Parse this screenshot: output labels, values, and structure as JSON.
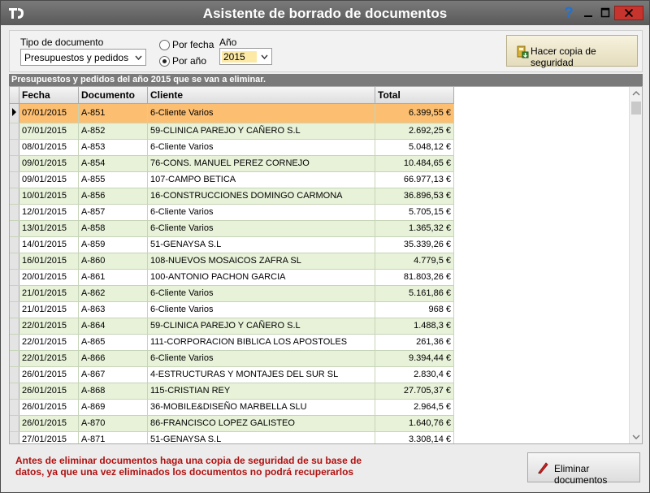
{
  "window": {
    "title": "Asistente de borrado de documentos"
  },
  "filters": {
    "doc_type_label": "Tipo de documento",
    "doc_type_value": "Presupuestos y pedidos",
    "radio_date_label": "Por fecha",
    "radio_year_label": "Por año",
    "year_label": "Año",
    "year_value": "2015",
    "backup_label": "Hacer copia de seguridad"
  },
  "grid": {
    "caption": "Presupuestos y pedidos del año 2015 que se van a eliminar.",
    "headers": [
      "Fecha",
      "Documento",
      "Cliente",
      "Total"
    ],
    "rows": [
      {
        "fecha": "07/01/2015",
        "documento": "A-851",
        "cliente": "6-Cliente Varios",
        "total": "6.399,55 €"
      },
      {
        "fecha": "07/01/2015",
        "documento": "A-852",
        "cliente": "59-CLINICA PAREJO Y CAÑERO S.L",
        "total": "2.692,25 €"
      },
      {
        "fecha": "08/01/2015",
        "documento": "A-853",
        "cliente": "6-Cliente Varios",
        "total": "5.048,12 €"
      },
      {
        "fecha": "09/01/2015",
        "documento": "A-854",
        "cliente": "76-CONS. MANUEL PEREZ CORNEJO",
        "total": "10.484,65 €"
      },
      {
        "fecha": "09/01/2015",
        "documento": "A-855",
        "cliente": "107-CAMPO BETICA",
        "total": "66.977,13 €"
      },
      {
        "fecha": "10/01/2015",
        "documento": "A-856",
        "cliente": "16-CONSTRUCCIONES DOMINGO CARMONA",
        "total": "36.896,53 €"
      },
      {
        "fecha": "12/01/2015",
        "documento": "A-857",
        "cliente": "6-Cliente Varios",
        "total": "5.705,15 €"
      },
      {
        "fecha": "13/01/2015",
        "documento": "A-858",
        "cliente": "6-Cliente Varios",
        "total": "1.365,32 €"
      },
      {
        "fecha": "14/01/2015",
        "documento": "A-859",
        "cliente": "51-GENAYSA S.L",
        "total": "35.339,26 €"
      },
      {
        "fecha": "16/01/2015",
        "documento": "A-860",
        "cliente": "108-NUEVOS MOSAICOS ZAFRA SL",
        "total": "4.779,5 €"
      },
      {
        "fecha": "20/01/2015",
        "documento": "A-861",
        "cliente": "100-ANTONIO PACHON GARCIA",
        "total": "81.803,26 €"
      },
      {
        "fecha": "21/01/2015",
        "documento": "A-862",
        "cliente": "6-Cliente Varios",
        "total": "5.161,86 €"
      },
      {
        "fecha": "21/01/2015",
        "documento": "A-863",
        "cliente": "6-Cliente Varios",
        "total": "968 €"
      },
      {
        "fecha": "22/01/2015",
        "documento": "A-864",
        "cliente": "59-CLINICA PAREJO Y CAÑERO S.L",
        "total": "1.488,3 €"
      },
      {
        "fecha": "22/01/2015",
        "documento": "A-865",
        "cliente": "111-CORPORACION BIBLICA LOS APOSTOLES",
        "total": "261,36 €"
      },
      {
        "fecha": "22/01/2015",
        "documento": "A-866",
        "cliente": "6-Cliente Varios",
        "total": "9.394,44 €"
      },
      {
        "fecha": "26/01/2015",
        "documento": "A-867",
        "cliente": "4-ESTRUCTURAS Y MONTAJES DEL SUR SL",
        "total": "2.830,4 €"
      },
      {
        "fecha": "26/01/2015",
        "documento": "A-868",
        "cliente": "115-CRISTIAN REY",
        "total": "27.705,37 €"
      },
      {
        "fecha": "26/01/2015",
        "documento": "A-869",
        "cliente": "36-MOBILE&DISEÑO MARBELLA SLU",
        "total": "2.964,5 €"
      },
      {
        "fecha": "26/01/2015",
        "documento": "A-870",
        "cliente": "86-FRANCISCO LOPEZ GALISTEO",
        "total": "1.640,76 €"
      },
      {
        "fecha": "27/01/2015",
        "documento": "A-871",
        "cliente": "51-GENAYSA S.L",
        "total": "3.308,14 €"
      }
    ]
  },
  "footer": {
    "warning": "Antes de eliminar documentos haga una copia de seguridad de su base de datos, ya que una vez eliminados los documentos no podrá recuperarlos",
    "delete_label": "Eliminar documentos"
  },
  "colors": {
    "selected_row": "#fcbf72",
    "alt_row": "#e8f2d9",
    "warning_text": "#b01010",
    "title_bar": "#6b6b6b"
  }
}
